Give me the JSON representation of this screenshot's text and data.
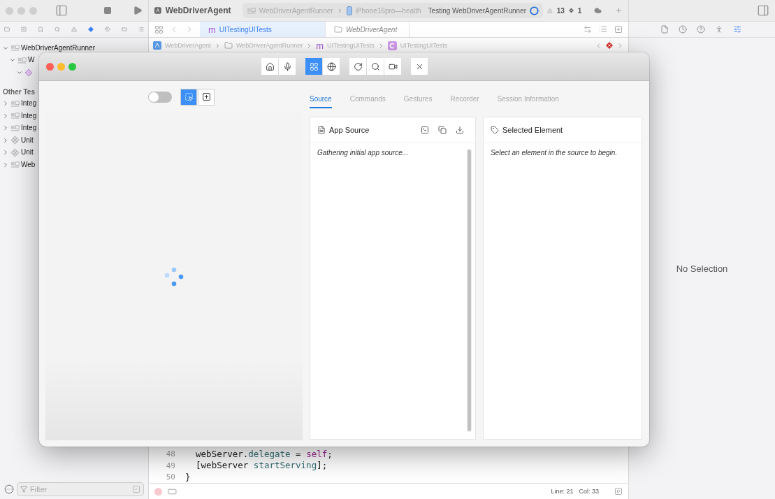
{
  "xcode": {
    "toolbar": {
      "project": "WebDriverAgent",
      "scheme": "WebDriverAgentRunner",
      "destination": "iPhone16pro—health",
      "activity": "Testing WebDriverAgentRunner",
      "warnings": "13",
      "errors": "1"
    },
    "navigator": {
      "items": [
        {
          "label": "WebDriverAgentRunner",
          "kind": "target",
          "expanded": true,
          "children": [
            {
              "label": "W",
              "kind": "target",
              "expanded": true,
              "children": [
                {
                  "kind": "class",
                  "expanded": true
                }
              ]
            }
          ]
        }
      ],
      "section": "Other Tes",
      "other_items": [
        {
          "label": "Integ",
          "kind": "target",
          "expanded": false
        },
        {
          "label": "Integ",
          "kind": "target",
          "expanded": false
        },
        {
          "label": "Integ",
          "kind": "target",
          "expanded": false
        },
        {
          "label": "Unit",
          "kind": "bundle",
          "expanded": false
        },
        {
          "label": "Unit",
          "kind": "bundle",
          "expanded": false
        },
        {
          "label": "Web",
          "kind": "target",
          "expanded": false
        }
      ],
      "filter": {
        "placeholder": "Filter"
      }
    },
    "editor_tabs": [
      {
        "label": "UITestingUITests",
        "kind": "source",
        "glyph": "m",
        "selected": true
      },
      {
        "label": "WebDriverAgent",
        "kind": "project",
        "selected": false
      }
    ],
    "breadcrumb": [
      {
        "label": "WebDriverAgent",
        "kind": "project"
      },
      {
        "label": "WebDriverAgentRunner",
        "kind": "folder"
      },
      {
        "label": "UITestingUITests",
        "kind": "source",
        "glyph": "m"
      },
      {
        "label": "UITestingUITests",
        "kind": "class"
      }
    ],
    "code": [
      {
        "number": "48",
        "tokens": [
          {
            "text": "webServer.",
            "kind": "plain"
          },
          {
            "text": "delegate",
            "kind": "member"
          },
          {
            "text": " = ",
            "kind": "plain"
          },
          {
            "text": "self",
            "kind": "keyword"
          },
          {
            "text": ";",
            "kind": "plain"
          }
        ]
      },
      {
        "number": "49",
        "tokens": [
          {
            "text": "[webServer ",
            "kind": "plain"
          },
          {
            "text": "startServing",
            "kind": "member"
          },
          {
            "text": "];",
            "kind": "plain"
          }
        ]
      },
      {
        "number": "50",
        "tokens": [
          {
            "text": "}",
            "kind": "plain"
          }
        ]
      }
    ],
    "status": {
      "line": "Line: 21",
      "column": "Col: 33"
    },
    "inspector_empty": "No Selection"
  },
  "appium": {
    "toolbar": [
      [
        {
          "kind": "home",
          "selected": false
        },
        {
          "kind": "mic",
          "selected": false
        }
      ],
      [
        {
          "kind": "grid",
          "selected": true
        },
        {
          "kind": "globe",
          "selected": false
        }
      ],
      [
        {
          "kind": "refresh",
          "selected": false
        },
        {
          "kind": "search",
          "selected": false
        },
        {
          "kind": "record",
          "selected": false
        }
      ],
      [
        {
          "kind": "close",
          "selected": false
        }
      ]
    ],
    "mode_switch": {
      "on": false
    },
    "mode_buttons": [
      {
        "kind": "select",
        "selected": true
      },
      {
        "kind": "add",
        "selected": false
      }
    ],
    "tabs": [
      {
        "label": "Source",
        "selected": true
      },
      {
        "label": "Commands",
        "selected": false
      },
      {
        "label": "Gestures",
        "selected": false
      },
      {
        "label": "Recorder",
        "selected": false
      },
      {
        "label": "Session Information",
        "selected": false
      }
    ],
    "source_panel": {
      "title": "App Source",
      "message": "Gathering initial app source..."
    },
    "element_panel": {
      "title": "Selected Element",
      "message": "Select an element in the source to begin."
    }
  }
}
